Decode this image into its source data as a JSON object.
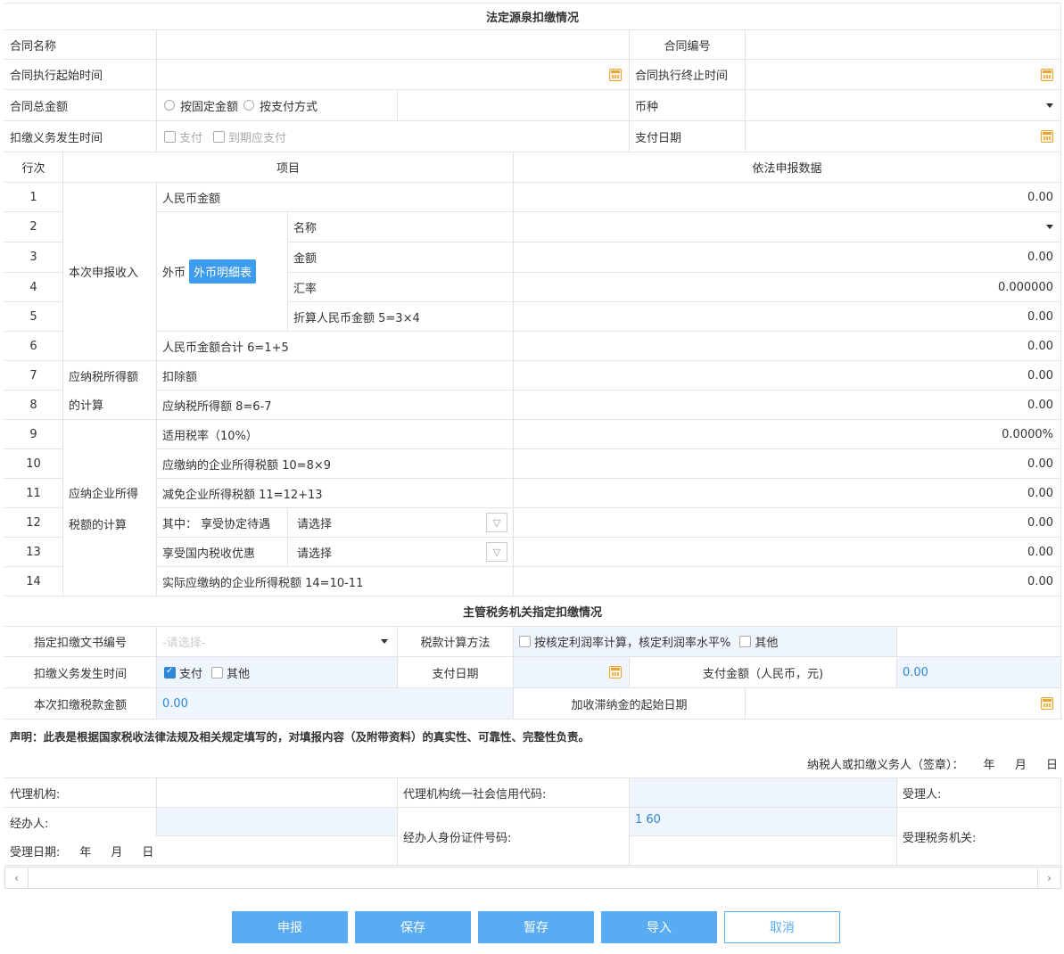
{
  "section1": {
    "title": "法定源泉扣缴情况"
  },
  "contract": {
    "name_label": "合同名称",
    "number_label": "合同编号",
    "start_label": "合同执行起始时间",
    "end_label": "合同执行终止时间",
    "total_label": "合同总金额",
    "radio_fixed": "按固定金额",
    "radio_payment": "按支付方式",
    "currency_label": "币种",
    "obligation_label": "扣缴义务发生时间",
    "chk_pay": "支付",
    "chk_due": "到期应支付",
    "pay_date_label": "支付日期"
  },
  "table": {
    "col_row": "行次",
    "col_item": "项目",
    "col_data": "依法申报数据",
    "group1": "本次申报收入",
    "group2a": "应纳税所得额",
    "group2b": "的计算",
    "group3a": "应纳企业所得",
    "group3b": "税额的计算",
    "foreign_label": "外币",
    "foreign_btn": "外币明细表",
    "select_placeholder": "请选择",
    "rows": [
      {
        "no": "1",
        "item": "人民币金额",
        "value": "0.00"
      },
      {
        "no": "2",
        "item": "名称",
        "value": ""
      },
      {
        "no": "3",
        "item": "金额",
        "value": "0.00"
      },
      {
        "no": "4",
        "item": "汇率",
        "value": "0.000000"
      },
      {
        "no": "5",
        "item": "折算人民币金额 5=3×4",
        "value": "0.00"
      },
      {
        "no": "6",
        "item": "人民币金额合计 6=1+5",
        "value": "0.00"
      },
      {
        "no": "7",
        "item": "扣除额",
        "value": "0.00"
      },
      {
        "no": "8",
        "item": "应纳税所得额 8=6-7",
        "value": "0.00"
      },
      {
        "no": "9",
        "item": "适用税率（10%）",
        "value": "0.0000%"
      },
      {
        "no": "10",
        "item": "应缴纳的企业所得税额 10=8×9",
        "value": "0.00"
      },
      {
        "no": "11",
        "item": "减免企业所得税额 11=12+13",
        "value": "0.00"
      },
      {
        "no": "12",
        "item": "其中： 享受协定待遇",
        "value": "0.00"
      },
      {
        "no": "13",
        "item": "享受国内税收优惠",
        "value": "0.00"
      },
      {
        "no": "14",
        "item": "实际应缴纳的企业所得税额 14=10-11",
        "value": "0.00"
      }
    ]
  },
  "section2": {
    "title": "主管税务机关指定扣缴情况",
    "doc_no_label": "指定扣缴文书编号",
    "doc_no_placeholder": "-请选择-",
    "calc_method_label": "税款计算方法",
    "calc_opt1": "按核定利润率计算，核定利润率水平%",
    "calc_opt2": "其他",
    "obligation_label": "扣缴义务发生时间",
    "obl_pay": "支付",
    "obl_other": "其他",
    "pay_date_label": "支付日期",
    "pay_amount_label": "支付金额（人民币，元)",
    "pay_amount_value": "0.00",
    "withhold_label": "本次扣缴税款金额",
    "withhold_value": "0.00",
    "late_fee_label": "加收滞纳金的起始日期"
  },
  "declaration": {
    "text": "声明：此表是根据国家税收法律法规及相关规定填写的，对填报内容（及附带资料）的真实性、可靠性、完整性负责。",
    "sign_label": "纳税人或扣缴义务人（签章）：",
    "year": "年",
    "month": "月",
    "day": "日"
  },
  "agent": {
    "agency_label": "代理机构:",
    "credit_code_label": "代理机构统一社会信用代码:",
    "receiver_label": "受理人:",
    "handler_label": "经办人:",
    "handler_id_label": "经办人身份证件号码:",
    "handler_id_value": "1 60",
    "tax_office_label": "受理税务机关:",
    "accept_date_label": "受理日期:",
    "year": "年",
    "month": "月",
    "day": "日"
  },
  "buttons": {
    "submit": "申报",
    "save": "保存",
    "draft": "暂存",
    "import": "导入",
    "cancel": "取消"
  }
}
